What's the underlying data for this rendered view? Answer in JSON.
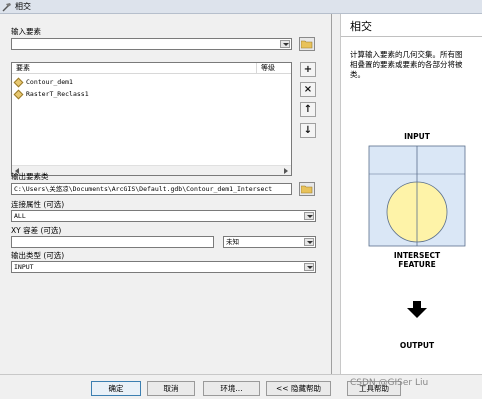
{
  "window": {
    "title": "相交",
    "icon": "tool-hammer-icon"
  },
  "form": {
    "input_features_label": "输入要素",
    "input_features_value": "",
    "list_header_features": "要素",
    "list_header_rank": "等级",
    "list_items": [
      {
        "label": "Contour_dem1"
      },
      {
        "label": "RasterT_Reclass1"
      }
    ],
    "side_buttons": [
      "+",
      "×",
      "↑",
      "↓"
    ],
    "output_label": "输出要素类",
    "output_value": "C:\\Users\\关悠凉\\Documents\\ArcGIS\\Default.gdb\\Contour_dem1_Intersect",
    "join_label": "连接属性 (可选)",
    "join_value": "ALL",
    "xy_label": "XY 容差 (可选)",
    "xy_value": "",
    "xy_unit": "未知",
    "output_type_label": "输出类型 (可选)",
    "output_type_value": "INPUT"
  },
  "help": {
    "title": "相交",
    "desc_lines": [
      "计算输入要素的几何交集。所有图",
      "相叠置的要素或要素的各部分将被",
      "类。"
    ],
    "input_caption": "INPUT",
    "intersect_caption_line1": "INTERSECT",
    "intersect_caption_line2": "FEATURE",
    "output_caption": "OUTPUT"
  },
  "buttons": {
    "ok": "确定",
    "cancel": "取消",
    "env": "环境...",
    "hide_help": "<< 隐藏帮助",
    "tool_help": "工具帮助"
  },
  "watermark": "CSDN @GISer Liu",
  "colors": {
    "accent": "#3c7fb1",
    "diagram_fill": "#fef3a8",
    "square_fill": "#dae7f6"
  }
}
